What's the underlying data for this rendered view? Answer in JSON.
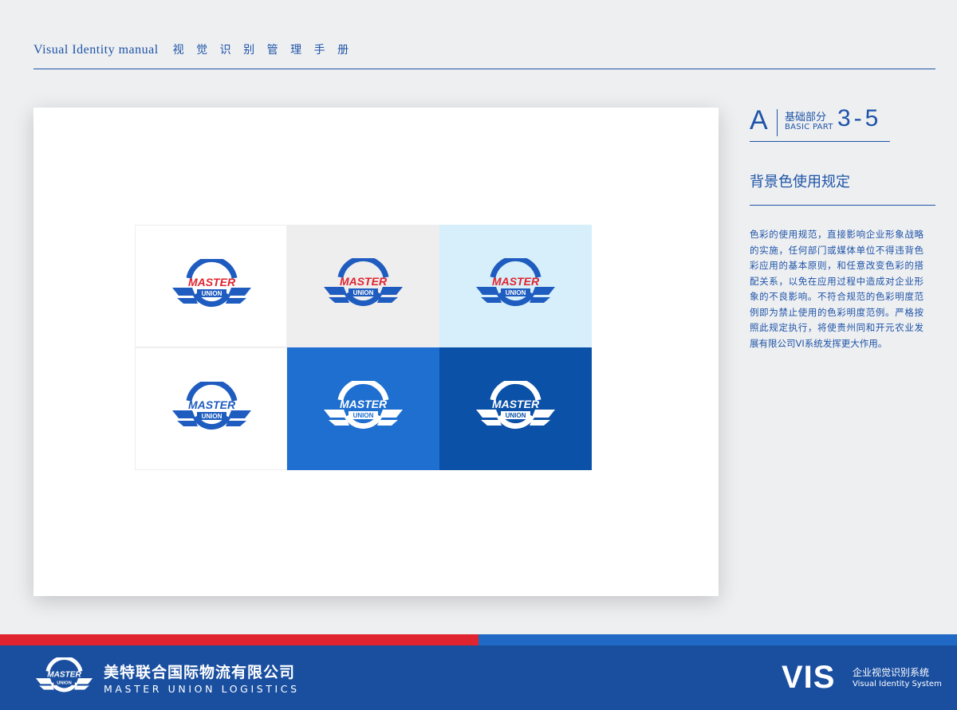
{
  "header": {
    "title_en": "Visual Identity manual",
    "title_cn": "视 觉 识 别 管 理 手 册"
  },
  "section": {
    "letter": "A",
    "name_cn": "基础部分",
    "name_en": "BASIC PART",
    "number": "3-5",
    "topic": "背景色使用规定",
    "body": "色彩的使用规范，直接影响企业形象战略的实施，任何部门或媒体单位不得违背色彩应用的基本原则，和任意改变色彩的搭配关系，以免在应用过程中造成对企业形象的不良影响。不符合规范的色彩明度范例即为禁止使用的色彩明度范例。严格按照此规定执行，将使贵州同和开元农业发展有限公司VI系统发挥更大作用。"
  },
  "logo": {
    "word1": "MASTER",
    "word2": "UNION"
  },
  "samples": [
    {
      "bg": "#ffffff",
      "ring": "#1f5cc0",
      "word1": "#e0242f",
      "word2": "#1f5cc0",
      "wings": "#1f5cc0",
      "word2_on_band": "#ffffff"
    },
    {
      "bg": "#eeeeee",
      "ring": "#1f5cc0",
      "word1": "#e0242f",
      "word2": "#1f5cc0",
      "wings": "#1f5cc0",
      "word2_on_band": "#ffffff"
    },
    {
      "bg": "#d6effa",
      "ring": "#1f5cc0",
      "word1": "#e0242f",
      "word2": "#1f5cc0",
      "wings": "#1f5cc0",
      "word2_on_band": "#ffffff"
    },
    {
      "bg": "#ffffff",
      "ring": "#1f5cc0",
      "word1": "#1f5cc0",
      "word2": "#1f5cc0",
      "wings": "#1f5cc0",
      "word2_on_band": "#ffffff"
    },
    {
      "bg": "#1f6fd0",
      "ring": "#ffffff",
      "word1": "#ffffff",
      "word2": "#ffffff",
      "wings": "#ffffff",
      "word2_on_band": "#1f6fd0"
    },
    {
      "bg": "#0b51a8",
      "ring": "#ffffff",
      "word1": "#ffffff",
      "word2": "#ffffff",
      "wings": "#ffffff",
      "word2_on_band": "#0b51a8"
    }
  ],
  "footer": {
    "company_cn": "美特联合国际物流有限公司",
    "company_en": "MASTER UNION LOGISTICS",
    "vis": "VIS",
    "vis_cn": "企业视觉识别系统",
    "vis_en": "Visual Identity System"
  },
  "colors": {
    "brand_blue": "#1a4fa0",
    "accent_red": "#e0242f",
    "page_bg": "#eeeff1"
  }
}
